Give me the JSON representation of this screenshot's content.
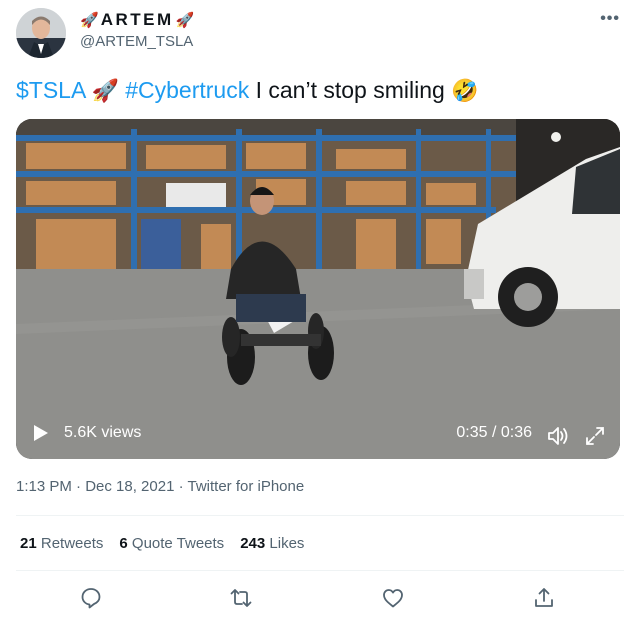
{
  "author": {
    "display_name": "ARTEM",
    "handle": "@ARTEM_TSLA",
    "name_emoji": "🚀",
    "avatar_icon": "profile-photo"
  },
  "tweet": {
    "cashtag": "$TSLA",
    "rocket": "🚀",
    "hashtag": "#Cybertruck",
    "text": " I can’t stop smiling ",
    "laugh_emoji": "🤣"
  },
  "video": {
    "views": "5.6K views",
    "time": "0:35 / 0:36",
    "progress": 0.97
  },
  "meta": "1:13 PM · Dec 18, 2021 · Twitter for iPhone",
  "stats": {
    "retweets_count": "21",
    "retweets_label": "Retweets",
    "quotes_count": "6",
    "quotes_label": "Quote Tweets",
    "likes_count": "243",
    "likes_label": "Likes"
  },
  "colors": {
    "link": "#1d9bf0",
    "secondary": "#536471",
    "text": "#0f1419"
  }
}
